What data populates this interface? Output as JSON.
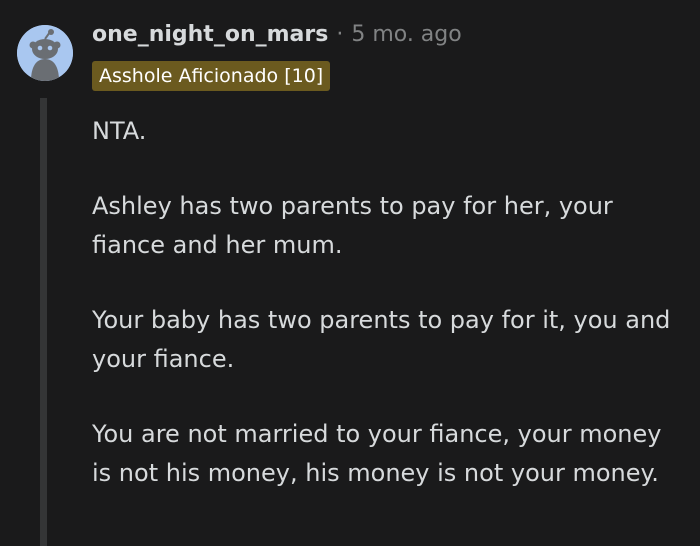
{
  "comment": {
    "username": "one_night_on_mars",
    "separator": "·",
    "timestamp": "5 mo. ago",
    "flair": "Asshole Aficionado [10]",
    "avatar_icon": "reddit-snoo-icon",
    "paragraphs": [
      "NTA.",
      "Ashley has two parents to pay for her, your fiance and her mum.",
      "Your baby has two parents to pay for it, you and your fiance.",
      "You are not married to your fiance, your money is not his money, his money is not your money."
    ]
  },
  "colors": {
    "background": "#1a1a1b",
    "text": "#d7dadc",
    "muted": "#818384",
    "flair_bg": "#6b5a1f",
    "avatar_bg": "#a9c7f0"
  }
}
